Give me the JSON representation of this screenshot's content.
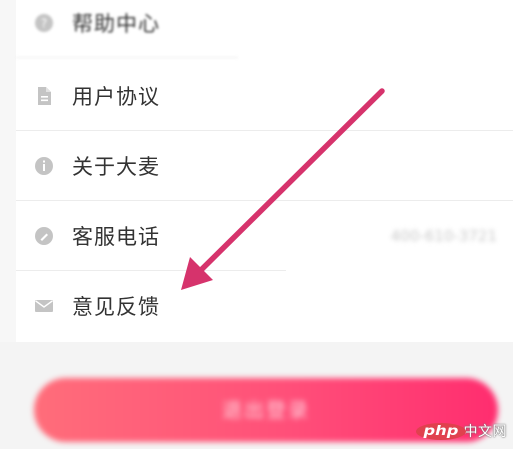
{
  "menu": {
    "items": [
      {
        "label": "帮助中心",
        "icon": "help-circle-icon"
      },
      {
        "label": "用户协议",
        "icon": "document-icon"
      },
      {
        "label": "关于大麦",
        "icon": "info-circle-icon"
      },
      {
        "label": "客服电话",
        "icon": "phone-circle-icon",
        "value": "400-610-3721"
      },
      {
        "label": "意见反馈",
        "icon": "mail-icon"
      }
    ]
  },
  "logout": {
    "label": "退出登录"
  },
  "annotation": {
    "arrow_color": "#d6336c"
  },
  "watermark": {
    "logo": "php",
    "text": "中文网"
  },
  "colors": {
    "accent_start": "#ff6d7a",
    "accent_end": "#ff2d6f",
    "icon_gray": "#c4c4c4",
    "text": "#333333"
  }
}
